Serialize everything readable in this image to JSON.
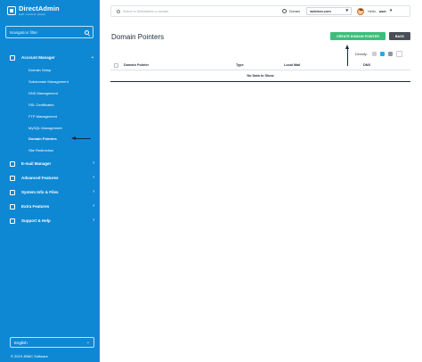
{
  "sidebar": {
    "logo": {
      "name": "DirectAdmin",
      "tagline": "web control panel"
    },
    "filter_placeholder": "Navigation filter",
    "groups": [
      {
        "label": "Account Manager",
        "icon": "account-icon",
        "expanded": true,
        "items": [
          "Domain Setup",
          "Subdomain Management",
          "DNS Management",
          "SSL Certificates",
          "FTP Management",
          "MySQL Management",
          "Domain Pointers",
          "Site Redirection"
        ],
        "active_item": "Domain Pointers"
      },
      {
        "label": "E-mail Manager",
        "icon": "email-icon"
      },
      {
        "label": "Advanced Features",
        "icon": "advanced-icon"
      },
      {
        "label": "System Info & Files",
        "icon": "system-icon"
      },
      {
        "label": "Extra Features",
        "icon": "extra-icon"
      },
      {
        "label": "Support & Help",
        "icon": "support-icon"
      }
    ],
    "language": "English",
    "copyright": "© 2019 JBMC Software"
  },
  "topbar": {
    "search_placeholder": "Search in DirectAdmin or domain",
    "domain_label": "Domain",
    "domain_value": "webtron.com",
    "hello": "Hello,",
    "username": "user"
  },
  "main": {
    "title": "Domain Pointers",
    "create_button": "CREATE DOMAIN POINTER",
    "back_button": "BACK",
    "density_label": "Density:",
    "columns": [
      "Domain Pointer",
      "Type",
      "Local Mail",
      "DNS"
    ],
    "empty_text": "No Data to Show"
  },
  "colors": {
    "sidebar_bg": "#0f88d4",
    "create_button": "#3bbf7a",
    "back_button": "#4a4f55"
  }
}
